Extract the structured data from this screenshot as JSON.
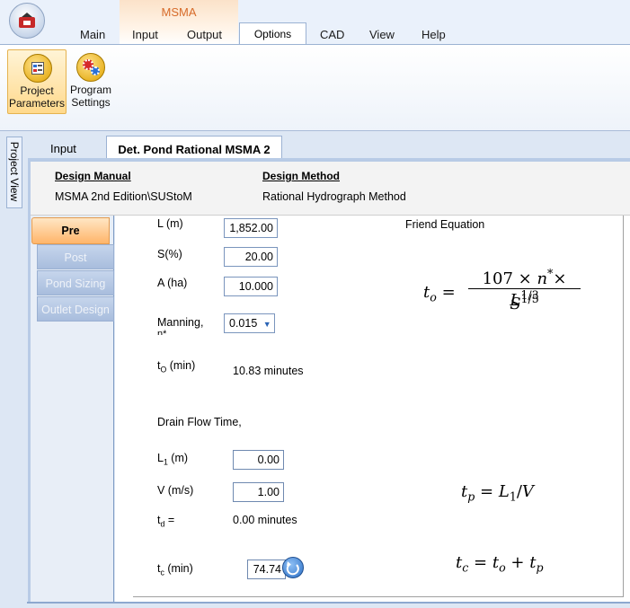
{
  "ribbon": {
    "context_group": "MSMA",
    "tabs": [
      "Main",
      "Input",
      "Output",
      "Options",
      "CAD",
      "View",
      "Help"
    ],
    "active_tab": "Options",
    "buttons": [
      {
        "label_line1": "Project",
        "label_line2": "Parameters"
      },
      {
        "label_line1": "Program",
        "label_line2": "Settings"
      }
    ]
  },
  "side_dock": {
    "label": "Project View"
  },
  "doc_tabs": [
    "Input",
    "Det. Pond Rational MSMA 2"
  ],
  "design": {
    "manual_label": "Design Manual",
    "manual_value": "MSMA 2nd Edition\\SUStoM",
    "method_label": "Design Method",
    "method_value": "Rational Hydrograph Method"
  },
  "side_tabs": [
    "Pre",
    "Post",
    "Pond Sizing",
    "Outlet Design"
  ],
  "form": {
    "L_label": "L (m)",
    "L_value": "1,852.00",
    "S_label": "S(%)",
    "S_value": "20.00",
    "A_label": "A (ha)",
    "A_value": "10.000",
    "manning_label": "Manning,",
    "manning_label2": "n*",
    "manning_value": "0.015",
    "to_label_main": "t",
    "to_label_sub": "O",
    "to_label_unit": " (min)",
    "to_value": "10.83 minutes",
    "drain_label": "Drain Flow Time,",
    "L1_label_main": "L",
    "L1_label_sub": "1",
    "L1_label_unit": " (m)",
    "L1_value": "0.00",
    "V_label": "V (m/s)",
    "V_value": "1.00",
    "td_label_main": "t",
    "td_label_sub": "d",
    "td_label_unit": " =",
    "td_value": "0.00 minutes",
    "tc_label_main": "t",
    "tc_label_sub": "c",
    "tc_label_unit": " (min)",
    "tc_value": "74.74"
  },
  "equations": {
    "friend_title": "Friend Equation"
  },
  "colors": {
    "accent_orange": "#ffb56a",
    "ribbon_blue": "#dde7f4",
    "context_orange": "#d76b2a"
  }
}
